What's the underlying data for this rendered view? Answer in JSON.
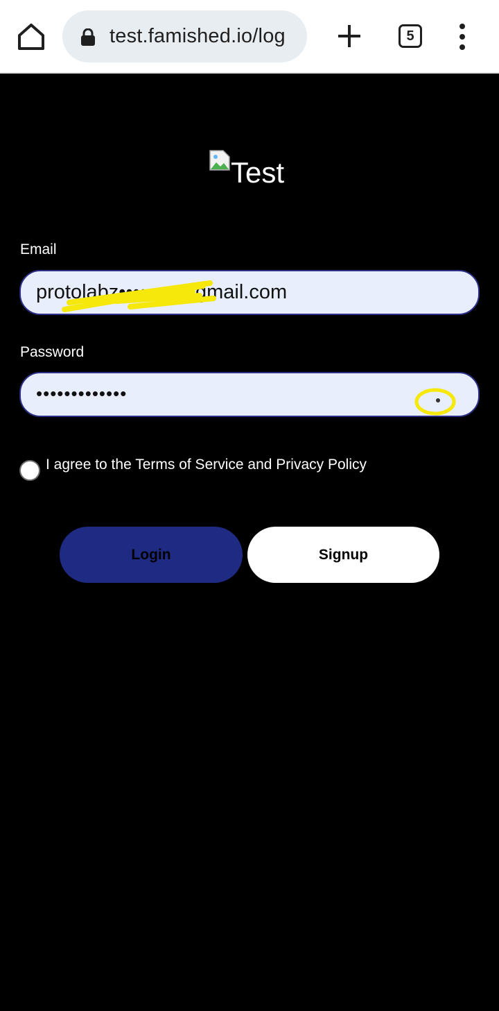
{
  "browser": {
    "url": "test.famished.io/log",
    "tab_count": "5",
    "icons": {
      "home": "home-icon",
      "lock": "lock-icon",
      "new_tab": "plus-icon",
      "menu": "more-vert-icon"
    }
  },
  "logo": {
    "alt_text": "Test"
  },
  "form": {
    "email_label": "Email",
    "email_value": "protolabz••••••••@gmail.com",
    "password_label": "Password",
    "password_value": "•••••••••••••",
    "terms_label": "I agree to the Terms of Service and Privacy Policy",
    "terms_checked": false
  },
  "buttons": {
    "login": "Login",
    "signup": "Signup"
  },
  "colors": {
    "background": "#000000",
    "field_bg": "#e8eefb",
    "field_border": "#2b2f86",
    "login_bg": "#1f2a82",
    "signup_bg": "#ffffff",
    "annotation": "#f5e80a"
  }
}
